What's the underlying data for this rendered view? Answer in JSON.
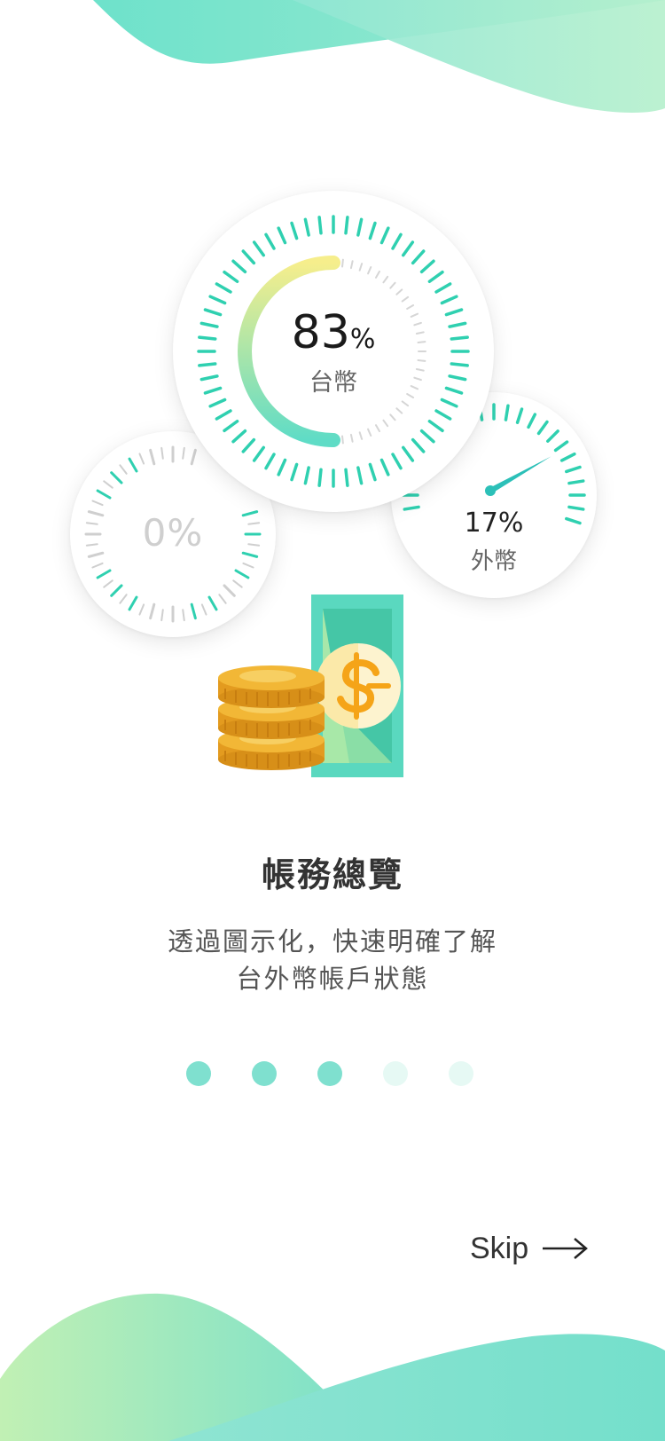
{
  "dials": {
    "domestic": {
      "percent": "83",
      "unit": "%",
      "label": "台幣",
      "fill_fraction": 0.83
    },
    "foreign": {
      "percent_text": "17%",
      "label": "外幣",
      "fill_fraction": 0.17
    },
    "other": {
      "percent_text": "0%",
      "fill_fraction": 0
    }
  },
  "title": "帳務總覽",
  "description": {
    "line1": "透過圖示化，快速明確了解",
    "line2": "台外幣帳戶狀態"
  },
  "pager": {
    "total": 5,
    "active_count": 3
  },
  "skip": {
    "label": "Skip"
  },
  "colors": {
    "accent": "#2fd0b0",
    "accent_light": "#7fe0cf",
    "yellow": "#f6ee8c",
    "dot_inactive": "#e6f9f4",
    "coin": "#e9a825",
    "bill": "#5ad8bf"
  },
  "icons": [
    "arrow-right-icon",
    "coins-icon",
    "banknote-icon",
    "dollar-sign-icon"
  ]
}
